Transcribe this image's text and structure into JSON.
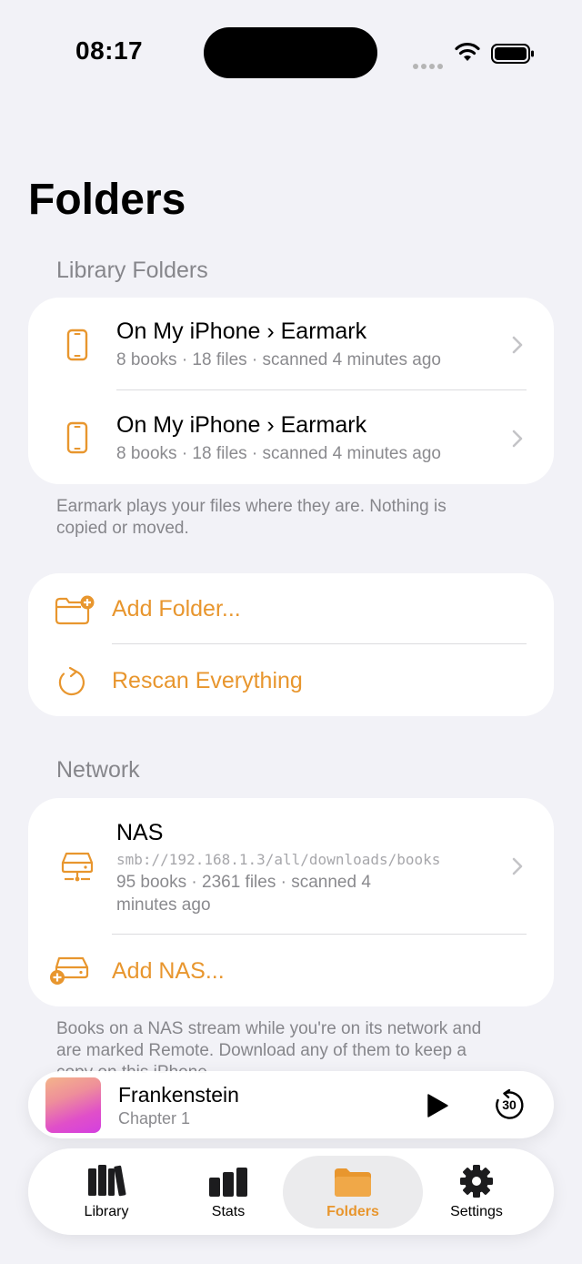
{
  "status_bar": {
    "time": "08:17"
  },
  "page_title": "Folders",
  "library_section": {
    "label": "Library Folders",
    "items": [
      {
        "title": "On My iPhone › Earmark",
        "subtitle": "8 books · 18 files · scanned 4 minutes ago"
      },
      {
        "title": "On My iPhone › Earmark",
        "subtitle": "8 books · 18 files · scanned 4 minutes ago"
      }
    ],
    "footnote_line1": "Earmark plays your files where they are. Nothing is",
    "footnote_line2": "copied or moved."
  },
  "actions": {
    "add_folder": "Add Folder...",
    "rescan": "Rescan Everything"
  },
  "network_section": {
    "label": "Network",
    "nas": {
      "title": "NAS",
      "path": "smb://192.168.1.3/all/downloads/books",
      "meta_line1": "95 books · 2361 files · scanned 4",
      "meta_line2": "minutes ago"
    },
    "add_nas": "Add NAS...",
    "footnote_line1": "Books on a NAS stream while you're on its network and",
    "footnote_line2": "are marked Remote. Download any of them to keep a",
    "footnote_line3": "copy on this iPhone."
  },
  "mini_player": {
    "title": "Frankenstein",
    "subtitle": "Chapter 1",
    "skip_label": "30"
  },
  "tab_bar": {
    "tabs": [
      {
        "label": "Library",
        "icon": "books-icon"
      },
      {
        "label": "Stats",
        "icon": "stats-icon"
      },
      {
        "label": "Folders",
        "icon": "folder-icon",
        "selected": true
      },
      {
        "label": "Settings",
        "icon": "gear-icon"
      }
    ]
  },
  "colors": {
    "accent": "#e8962e",
    "background": "#f2f2f7",
    "secondary_text": "#8a8a8e"
  }
}
